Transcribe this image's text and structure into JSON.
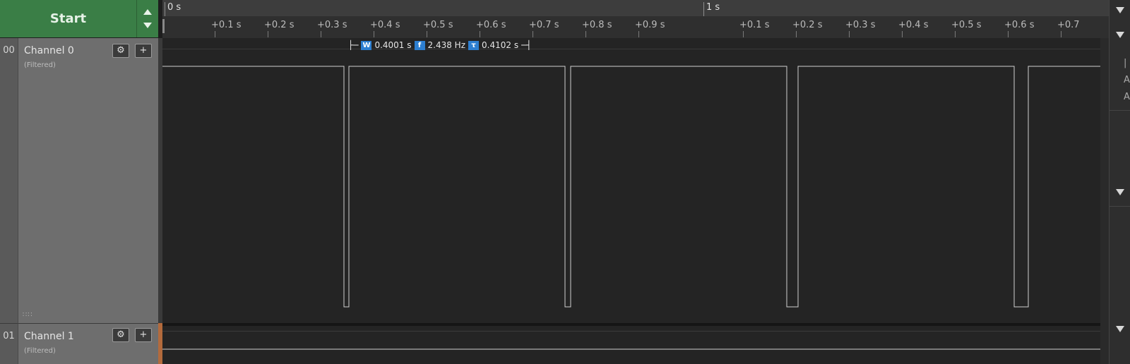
{
  "toolbar": {
    "start_label": "Start"
  },
  "timeline": {
    "top_labels": [
      {
        "text": "0 s"
      },
      {
        "text": "1 s"
      }
    ],
    "tick_labels": [
      "+0.1 s",
      "+0.2 s",
      "+0.3 s",
      "+0.4 s",
      "+0.5 s",
      "+0.6 s",
      "+0.7 s",
      "+0.8 s",
      "+0.9 s",
      "+0.1 s",
      "+0.2 s",
      "+0.3 s",
      "+0.4 s",
      "+0.5 s",
      "+0.6 s",
      "+0.7"
    ]
  },
  "measurement": {
    "width_badge": "W",
    "width_value": "0.4001 s",
    "freq_badge": "f",
    "freq_value": "2.438 Hz",
    "period_badge": "τ",
    "period_value": "0.4102 s"
  },
  "channels": [
    {
      "number": "00",
      "name": "Channel 0",
      "status": "(Filtered)"
    },
    {
      "number": "01",
      "name": "Channel 1",
      "status": "(Filtered)"
    }
  ],
  "right_panel": {
    "texts": [
      "|",
      "A",
      "A"
    ]
  },
  "colors": {
    "start_green": "#3a7e46",
    "badge_blue": "#2d7fd1",
    "signal": "#d0d0d0",
    "plot_bg": "#242424"
  }
}
